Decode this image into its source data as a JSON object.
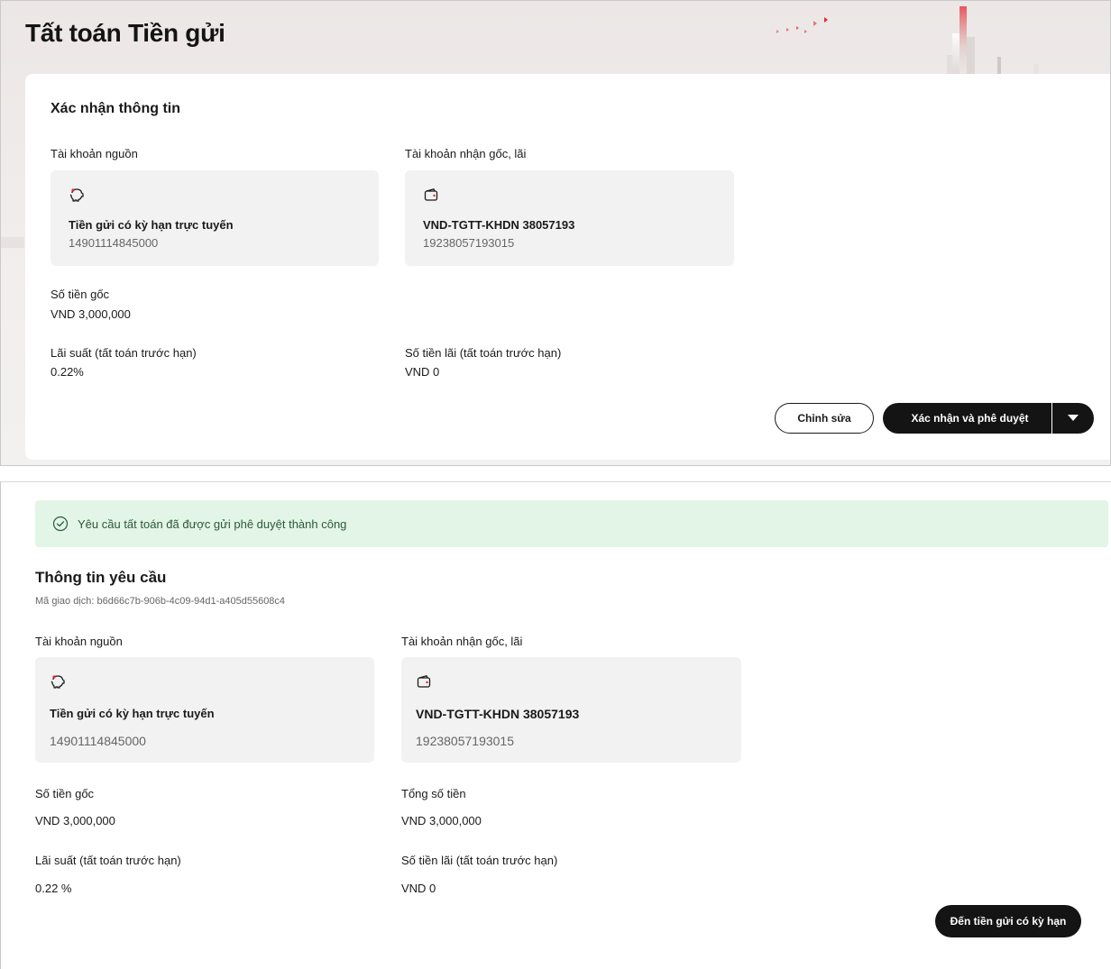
{
  "page": {
    "title": "Tất toán Tiền gửi"
  },
  "confirm_section": {
    "heading": "Xác nhận thông tin",
    "source_account": {
      "label": "Tài khoản nguồn",
      "icon": "piggy-bank-icon",
      "name": "Tiền gửi có kỳ hạn trực tuyến",
      "number": "14901114845000"
    },
    "receiving_account": {
      "label": "Tài khoản nhận gốc, lãi",
      "icon": "wallet-icon",
      "name": "VND-TGTT-KHDN 38057193",
      "number": "19238057193015"
    },
    "principal": {
      "label": "Số tiền gốc",
      "value": "VND 3,000,000"
    },
    "interest_rate": {
      "label": "Lãi suất (tất toán trước hạn)",
      "value": "0.22%"
    },
    "interest_amount": {
      "label": "Số tiền lãi (tất toán trước hạn)",
      "value": "VND 0"
    },
    "edit_button": "Chỉnh sửa",
    "confirm_button": "Xác nhận và phê duyệt"
  },
  "result_section": {
    "banner": "Yêu cầu tất toán đã được gửi phê duyệt thành công",
    "heading": "Thông tin yêu cầu",
    "transaction_id": "Mã giao dịch: b6d66c7b-906b-4c09-94d1-a405d55608c4",
    "source_account": {
      "label": "Tài khoản nguồn",
      "icon": "piggy-bank-icon",
      "name": "Tiền gửi có kỳ hạn trực tuyến",
      "number": "14901114845000"
    },
    "receiving_account": {
      "label": "Tài khoản nhận gốc, lãi",
      "icon": "wallet-icon",
      "name": "VND-TGTT-KHDN 38057193",
      "number": "19238057193015"
    },
    "principal": {
      "label": "Số tiền gốc",
      "value": "VND 3,000,000"
    },
    "total": {
      "label": "Tổng số tiền",
      "value": "VND 3,000,000"
    },
    "interest_rate": {
      "label": "Lãi suất (tất toán trước hạn)",
      "value": "0.22 %"
    },
    "interest_amount": {
      "label": "Số tiền lãi (tất toán trước hạn)",
      "value": "VND 0"
    },
    "goto_button": "Đến tiền gửi có kỳ hạn"
  },
  "colors": {
    "accent_red": "#e8262e",
    "primary_dark": "#141414",
    "success_bg": "#e2f5e6",
    "success_text": "#2c5a37"
  }
}
